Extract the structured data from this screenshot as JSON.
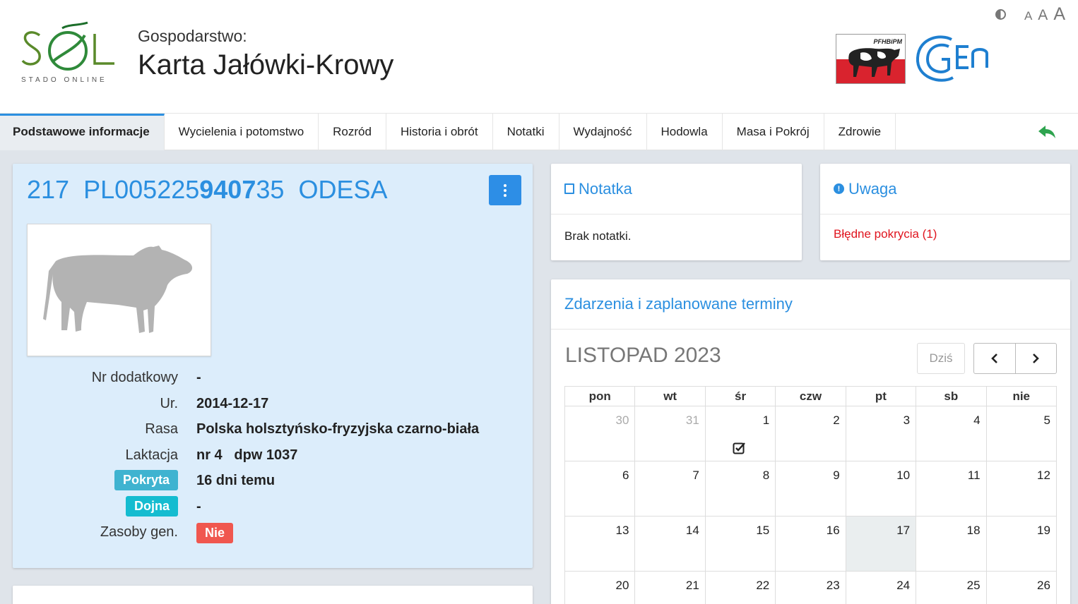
{
  "header": {
    "logo_text": "SOL",
    "logo_subtitle": "STADO ONLINE",
    "farm_label": "Gospodarstwo:",
    "title": "Karta Jałówki-Krowy",
    "font_sizes": [
      "A",
      "A",
      "A"
    ],
    "partner_logo_text": "PFHBiPM",
    "gen_logo_text": "GEN"
  },
  "tabs": [
    {
      "label": "Podstawowe informacje",
      "active": true
    },
    {
      "label": "Wycielenia i potomstwo"
    },
    {
      "label": "Rozród"
    },
    {
      "label": "Historia i obrót"
    },
    {
      "label": "Notatki"
    },
    {
      "label": "Wydajność"
    },
    {
      "label": "Hodowla"
    },
    {
      "label": "Masa i Pokrój"
    },
    {
      "label": "Zdrowie"
    }
  ],
  "animal": {
    "number": "217",
    "id_prefix": "PL005225",
    "id_bold": "9407",
    "id_mid": "3",
    "id_bold2": "",
    "id_suffix": "5",
    "name": "ODESA",
    "rows": [
      {
        "label": "Nr dodatkowy",
        "value": "-"
      },
      {
        "label": "Ur.",
        "value": "2014-12-17"
      },
      {
        "label": "Rasa",
        "value": "Polska holsztyńsko-fryzyjska czarno-biała"
      },
      {
        "label": "Laktacja",
        "value": "nr 4   dpw 1037"
      },
      {
        "label": "Pokryta",
        "value": "16 dni temu",
        "badge": "cyan"
      },
      {
        "label": "Dojna",
        "value": "-",
        "badge": "teal"
      },
      {
        "label": "Zasoby gen.",
        "value": "Nie",
        "value_badge": "red"
      }
    ]
  },
  "note": {
    "title": "Notatka",
    "body": "Brak notatki."
  },
  "warning": {
    "title": "Uwaga",
    "body": "Błędne pokrycia (1)"
  },
  "calendar": {
    "title": "Zdarzenia i zaplanowane terminy",
    "month": "LISTOPAD 2023",
    "today_label": "Dziś",
    "weekdays": [
      "pon",
      "wt",
      "śr",
      "czw",
      "pt",
      "sb",
      "nie"
    ],
    "weeks": [
      [
        {
          "d": "30",
          "other": true
        },
        {
          "d": "31",
          "other": true
        },
        {
          "d": "1",
          "event": true
        },
        {
          "d": "2"
        },
        {
          "d": "3"
        },
        {
          "d": "4"
        },
        {
          "d": "5"
        }
      ],
      [
        {
          "d": "6"
        },
        {
          "d": "7"
        },
        {
          "d": "8"
        },
        {
          "d": "9"
        },
        {
          "d": "10"
        },
        {
          "d": "11"
        },
        {
          "d": "12"
        }
      ],
      [
        {
          "d": "13"
        },
        {
          "d": "14"
        },
        {
          "d": "15"
        },
        {
          "d": "16"
        },
        {
          "d": "17",
          "today": true
        },
        {
          "d": "18"
        },
        {
          "d": "19"
        }
      ],
      [
        {
          "d": "20"
        },
        {
          "d": "21"
        },
        {
          "d": "22"
        },
        {
          "d": "23"
        },
        {
          "d": "24"
        },
        {
          "d": "25"
        },
        {
          "d": "26"
        }
      ]
    ]
  },
  "colors": {
    "accent": "#2b8fe0",
    "error": "#e0141e",
    "card_bg": "#dcedfb"
  }
}
